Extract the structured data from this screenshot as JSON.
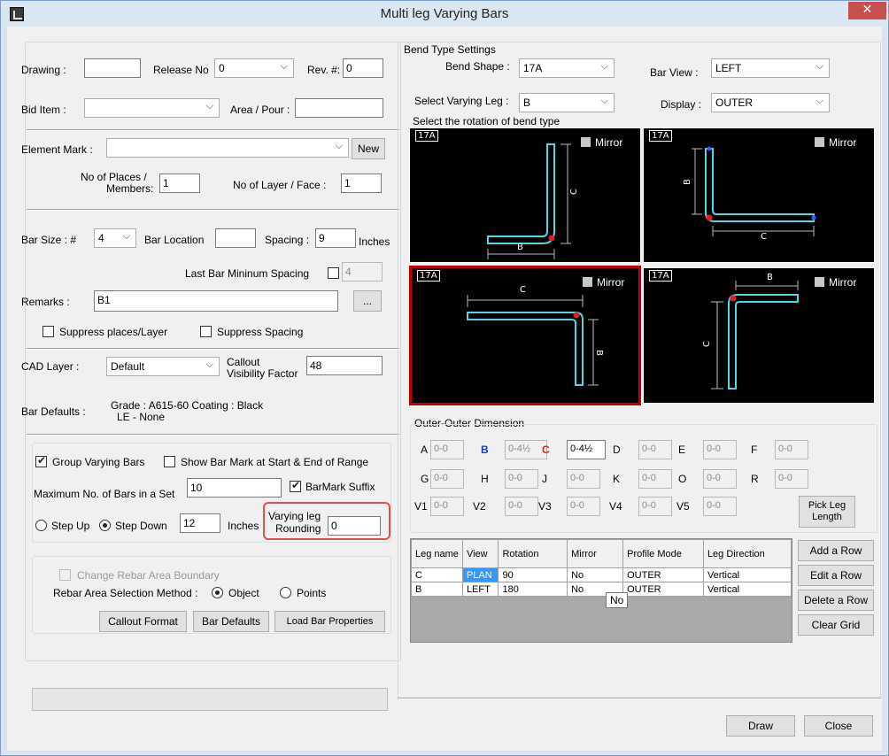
{
  "window": {
    "title": "Multi leg Varying Bars",
    "close": "✕"
  },
  "drawing": {
    "label": "Drawing :",
    "value": ""
  },
  "release": {
    "label": "Release No",
    "value": "0"
  },
  "rev": {
    "label": "Rev. #:",
    "value": "0"
  },
  "bid_item": {
    "label": "Bid Item :",
    "value": ""
  },
  "area_pour": {
    "label": "Area / Pour :",
    "value": ""
  },
  "element_mark": {
    "label": "Element Mark :",
    "value": "",
    "new_label": "New"
  },
  "places": {
    "label1": "No of Places /",
    "label2": "Members:",
    "value": "1"
  },
  "layers": {
    "label": "No of Layer / Face :",
    "value": "1"
  },
  "bar_size": {
    "label": "Bar Size : #",
    "value": "4"
  },
  "bar_location": {
    "label": "Bar Location",
    "value": ""
  },
  "spacing": {
    "label": "Spacing :",
    "value": "9",
    "unit": "Inches"
  },
  "last_bar": {
    "label": "Last Bar Mininum Spacing",
    "value": "4"
  },
  "remarks": {
    "label": "Remarks :",
    "value": "B1",
    "ellipsis": "..."
  },
  "suppress_places": "Suppress places/Layer",
  "suppress_spacing": "Suppress Spacing",
  "cad_layer": {
    "label": "CAD Layer :",
    "value": "Default"
  },
  "callout": {
    "label1": "Callout",
    "label2": "Visibility Factor",
    "value": "48"
  },
  "bar_defaults": {
    "label": "Bar Defaults :",
    "line1": "Grade : A615-60 Coating : Black",
    "line2": "LE - None"
  },
  "group_varying": "Group Varying Bars",
  "show_bar_mark": "Show Bar Mark at Start & End of Range",
  "max_bars": {
    "label": "Maximum No. of Bars in a Set",
    "value": "10"
  },
  "barmark_suffix": "BarMark Suffix",
  "step_up": "Step Up",
  "step_down": "Step Down",
  "step_value": "12",
  "step_unit": "Inches",
  "rounding": {
    "label1": "Varying leg",
    "label2": "Rounding",
    "value": "0"
  },
  "change_boundary": "Change Rebar Area Boundary",
  "selection_method": {
    "label": "Rebar Area Selection Method :",
    "object": "Object",
    "points": "Points"
  },
  "buttons_left": {
    "callout_format": "Callout Format",
    "bar_defaults": "Bar Defaults",
    "load_props": "Load Bar Properties"
  },
  "bend": {
    "group_label": "Bend Type Settings",
    "shape_label": "Bend Shape :",
    "shape_value": "17A",
    "bar_view_label": "Bar View :",
    "bar_view_value": "LEFT",
    "vary_leg_label": "Select Varying Leg :",
    "vary_leg_value": "B",
    "display_label": "Display :",
    "display_value": "OUTER",
    "rotation_label": "Select the rotation of bend type"
  },
  "panels": [
    {
      "tag": "17A",
      "mirror": "Mirror",
      "dim1": "C",
      "dim2": "B"
    },
    {
      "tag": "17A",
      "mirror": "Mirror",
      "dim1": "B",
      "dim2": "C"
    },
    {
      "tag": "17A",
      "mirror": "Mirror",
      "dim1": "C",
      "dim2": "B"
    },
    {
      "tag": "17A",
      "mirror": "Mirror",
      "dim1": "B",
      "dim2": "C"
    }
  ],
  "ood": {
    "label": "Outer-Outer Dimension",
    "fields": [
      {
        "n": "A",
        "v": "0-0"
      },
      {
        "n": "B",
        "v": "0-4½"
      },
      {
        "n": "C",
        "v": "0-4½"
      },
      {
        "n": "D",
        "v": "0-0"
      },
      {
        "n": "E",
        "v": "0-0"
      },
      {
        "n": "F",
        "v": "0-0"
      },
      {
        "n": "G",
        "v": "0-0"
      },
      {
        "n": "H",
        "v": "0-0"
      },
      {
        "n": "J",
        "v": "0-0"
      },
      {
        "n": "K",
        "v": "0-0"
      },
      {
        "n": "O",
        "v": "0-0"
      },
      {
        "n": "R",
        "v": "0-0"
      },
      {
        "n": "V1",
        "v": "0-0"
      },
      {
        "n": "V2",
        "v": "0-0"
      },
      {
        "n": "V3",
        "v": "0-0"
      },
      {
        "n": "V4",
        "v": "0-0"
      },
      {
        "n": "V5",
        "v": "0-0"
      }
    ],
    "pick_leg": "Pick Leg Length"
  },
  "grid": {
    "headers": [
      "Leg name",
      "View",
      "Rotation",
      "Mirror",
      "Profile Mode",
      "Leg Direction"
    ],
    "rows": [
      [
        "C",
        "PLAN",
        "90",
        "No",
        "OUTER",
        "Vertical"
      ],
      [
        "B",
        "LEFT",
        "180",
        "No",
        "OUTER",
        "Vertical"
      ]
    ],
    "tooltip": "No"
  },
  "grid_buttons": {
    "add": "Add a Row",
    "edit": "Edit a Row",
    "delete": "Delete a Row",
    "clear": "Clear Grid"
  },
  "bottom": {
    "draw": "Draw",
    "close": "Close"
  }
}
